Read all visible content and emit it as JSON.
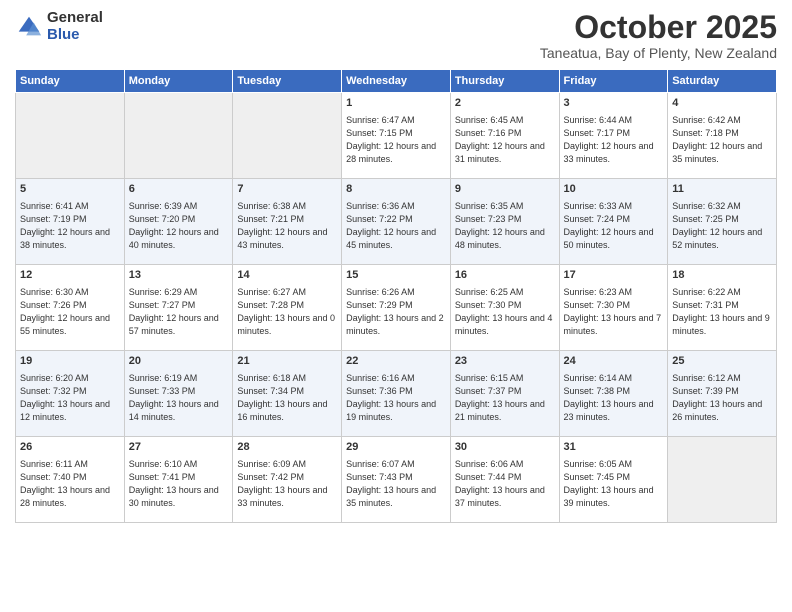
{
  "logo": {
    "general": "General",
    "blue": "Blue"
  },
  "title": "October 2025",
  "subtitle": "Taneatua, Bay of Plenty, New Zealand",
  "weekdays": [
    "Sunday",
    "Monday",
    "Tuesday",
    "Wednesday",
    "Thursday",
    "Friday",
    "Saturday"
  ],
  "weeks": [
    [
      {
        "day": "",
        "sunrise": "",
        "sunset": "",
        "daylight": ""
      },
      {
        "day": "",
        "sunrise": "",
        "sunset": "",
        "daylight": ""
      },
      {
        "day": "",
        "sunrise": "",
        "sunset": "",
        "daylight": ""
      },
      {
        "day": "1",
        "sunrise": "Sunrise: 6:47 AM",
        "sunset": "Sunset: 7:15 PM",
        "daylight": "Daylight: 12 hours and 28 minutes."
      },
      {
        "day": "2",
        "sunrise": "Sunrise: 6:45 AM",
        "sunset": "Sunset: 7:16 PM",
        "daylight": "Daylight: 12 hours and 31 minutes."
      },
      {
        "day": "3",
        "sunrise": "Sunrise: 6:44 AM",
        "sunset": "Sunset: 7:17 PM",
        "daylight": "Daylight: 12 hours and 33 minutes."
      },
      {
        "day": "4",
        "sunrise": "Sunrise: 6:42 AM",
        "sunset": "Sunset: 7:18 PM",
        "daylight": "Daylight: 12 hours and 35 minutes."
      }
    ],
    [
      {
        "day": "5",
        "sunrise": "Sunrise: 6:41 AM",
        "sunset": "Sunset: 7:19 PM",
        "daylight": "Daylight: 12 hours and 38 minutes."
      },
      {
        "day": "6",
        "sunrise": "Sunrise: 6:39 AM",
        "sunset": "Sunset: 7:20 PM",
        "daylight": "Daylight: 12 hours and 40 minutes."
      },
      {
        "day": "7",
        "sunrise": "Sunrise: 6:38 AM",
        "sunset": "Sunset: 7:21 PM",
        "daylight": "Daylight: 12 hours and 43 minutes."
      },
      {
        "day": "8",
        "sunrise": "Sunrise: 6:36 AM",
        "sunset": "Sunset: 7:22 PM",
        "daylight": "Daylight: 12 hours and 45 minutes."
      },
      {
        "day": "9",
        "sunrise": "Sunrise: 6:35 AM",
        "sunset": "Sunset: 7:23 PM",
        "daylight": "Daylight: 12 hours and 48 minutes."
      },
      {
        "day": "10",
        "sunrise": "Sunrise: 6:33 AM",
        "sunset": "Sunset: 7:24 PM",
        "daylight": "Daylight: 12 hours and 50 minutes."
      },
      {
        "day": "11",
        "sunrise": "Sunrise: 6:32 AM",
        "sunset": "Sunset: 7:25 PM",
        "daylight": "Daylight: 12 hours and 52 minutes."
      }
    ],
    [
      {
        "day": "12",
        "sunrise": "Sunrise: 6:30 AM",
        "sunset": "Sunset: 7:26 PM",
        "daylight": "Daylight: 12 hours and 55 minutes."
      },
      {
        "day": "13",
        "sunrise": "Sunrise: 6:29 AM",
        "sunset": "Sunset: 7:27 PM",
        "daylight": "Daylight: 12 hours and 57 minutes."
      },
      {
        "day": "14",
        "sunrise": "Sunrise: 6:27 AM",
        "sunset": "Sunset: 7:28 PM",
        "daylight": "Daylight: 13 hours and 0 minutes."
      },
      {
        "day": "15",
        "sunrise": "Sunrise: 6:26 AM",
        "sunset": "Sunset: 7:29 PM",
        "daylight": "Daylight: 13 hours and 2 minutes."
      },
      {
        "day": "16",
        "sunrise": "Sunrise: 6:25 AM",
        "sunset": "Sunset: 7:30 PM",
        "daylight": "Daylight: 13 hours and 4 minutes."
      },
      {
        "day": "17",
        "sunrise": "Sunrise: 6:23 AM",
        "sunset": "Sunset: 7:30 PM",
        "daylight": "Daylight: 13 hours and 7 minutes."
      },
      {
        "day": "18",
        "sunrise": "Sunrise: 6:22 AM",
        "sunset": "Sunset: 7:31 PM",
        "daylight": "Daylight: 13 hours and 9 minutes."
      }
    ],
    [
      {
        "day": "19",
        "sunrise": "Sunrise: 6:20 AM",
        "sunset": "Sunset: 7:32 PM",
        "daylight": "Daylight: 13 hours and 12 minutes."
      },
      {
        "day": "20",
        "sunrise": "Sunrise: 6:19 AM",
        "sunset": "Sunset: 7:33 PM",
        "daylight": "Daylight: 13 hours and 14 minutes."
      },
      {
        "day": "21",
        "sunrise": "Sunrise: 6:18 AM",
        "sunset": "Sunset: 7:34 PM",
        "daylight": "Daylight: 13 hours and 16 minutes."
      },
      {
        "day": "22",
        "sunrise": "Sunrise: 6:16 AM",
        "sunset": "Sunset: 7:36 PM",
        "daylight": "Daylight: 13 hours and 19 minutes."
      },
      {
        "day": "23",
        "sunrise": "Sunrise: 6:15 AM",
        "sunset": "Sunset: 7:37 PM",
        "daylight": "Daylight: 13 hours and 21 minutes."
      },
      {
        "day": "24",
        "sunrise": "Sunrise: 6:14 AM",
        "sunset": "Sunset: 7:38 PM",
        "daylight": "Daylight: 13 hours and 23 minutes."
      },
      {
        "day": "25",
        "sunrise": "Sunrise: 6:12 AM",
        "sunset": "Sunset: 7:39 PM",
        "daylight": "Daylight: 13 hours and 26 minutes."
      }
    ],
    [
      {
        "day": "26",
        "sunrise": "Sunrise: 6:11 AM",
        "sunset": "Sunset: 7:40 PM",
        "daylight": "Daylight: 13 hours and 28 minutes."
      },
      {
        "day": "27",
        "sunrise": "Sunrise: 6:10 AM",
        "sunset": "Sunset: 7:41 PM",
        "daylight": "Daylight: 13 hours and 30 minutes."
      },
      {
        "day": "28",
        "sunrise": "Sunrise: 6:09 AM",
        "sunset": "Sunset: 7:42 PM",
        "daylight": "Daylight: 13 hours and 33 minutes."
      },
      {
        "day": "29",
        "sunrise": "Sunrise: 6:07 AM",
        "sunset": "Sunset: 7:43 PM",
        "daylight": "Daylight: 13 hours and 35 minutes."
      },
      {
        "day": "30",
        "sunrise": "Sunrise: 6:06 AM",
        "sunset": "Sunset: 7:44 PM",
        "daylight": "Daylight: 13 hours and 37 minutes."
      },
      {
        "day": "31",
        "sunrise": "Sunrise: 6:05 AM",
        "sunset": "Sunset: 7:45 PM",
        "daylight": "Daylight: 13 hours and 39 minutes."
      },
      {
        "day": "",
        "sunrise": "",
        "sunset": "",
        "daylight": ""
      }
    ]
  ]
}
